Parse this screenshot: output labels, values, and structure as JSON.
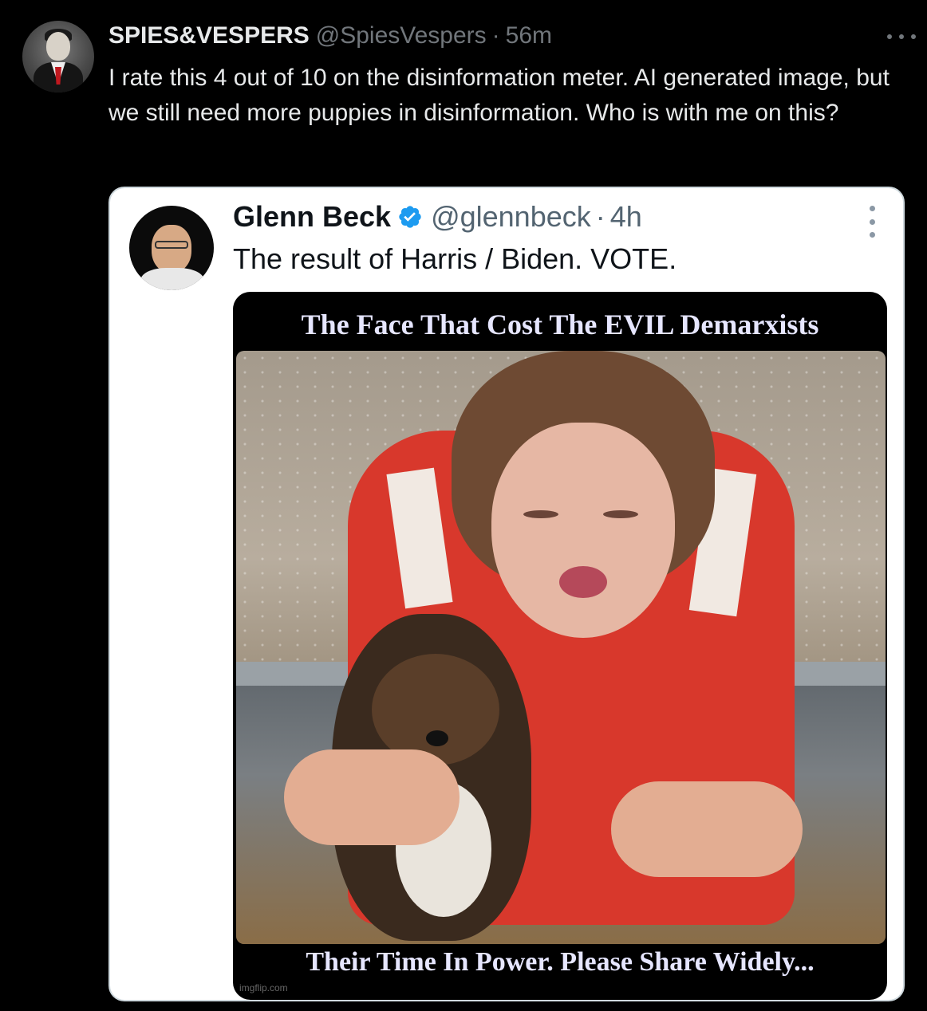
{
  "tweet": {
    "display_name": "SPIES&VESPERS",
    "handle": "@SpiesVespers",
    "separator": "·",
    "time": "56m",
    "text": "I rate this 4 out of 10 on the disinformation meter. AI generated image, but we still need more puppies in disinformation. Who is with me on this?",
    "avatar_icon": "avatar-icon",
    "more_icon": "more-icon"
  },
  "quote": {
    "display_name": "Glenn Beck",
    "handle": "@glennbeck",
    "separator": "·",
    "time": "4h",
    "text": "The result of Harris / Biden.  VOTE.",
    "verified_color": "#1d9bf0",
    "meme": {
      "top_caption": "The Face That Cost The EVIL Demarxists",
      "bottom_caption": "Their Time In Power.  Please Share Widely...",
      "watermark": "imgflip.com"
    }
  },
  "colors": {
    "background": "#000000",
    "text_primary": "#e7e9ea",
    "text_secondary": "#71767b",
    "quote_background": "#ffffff"
  }
}
